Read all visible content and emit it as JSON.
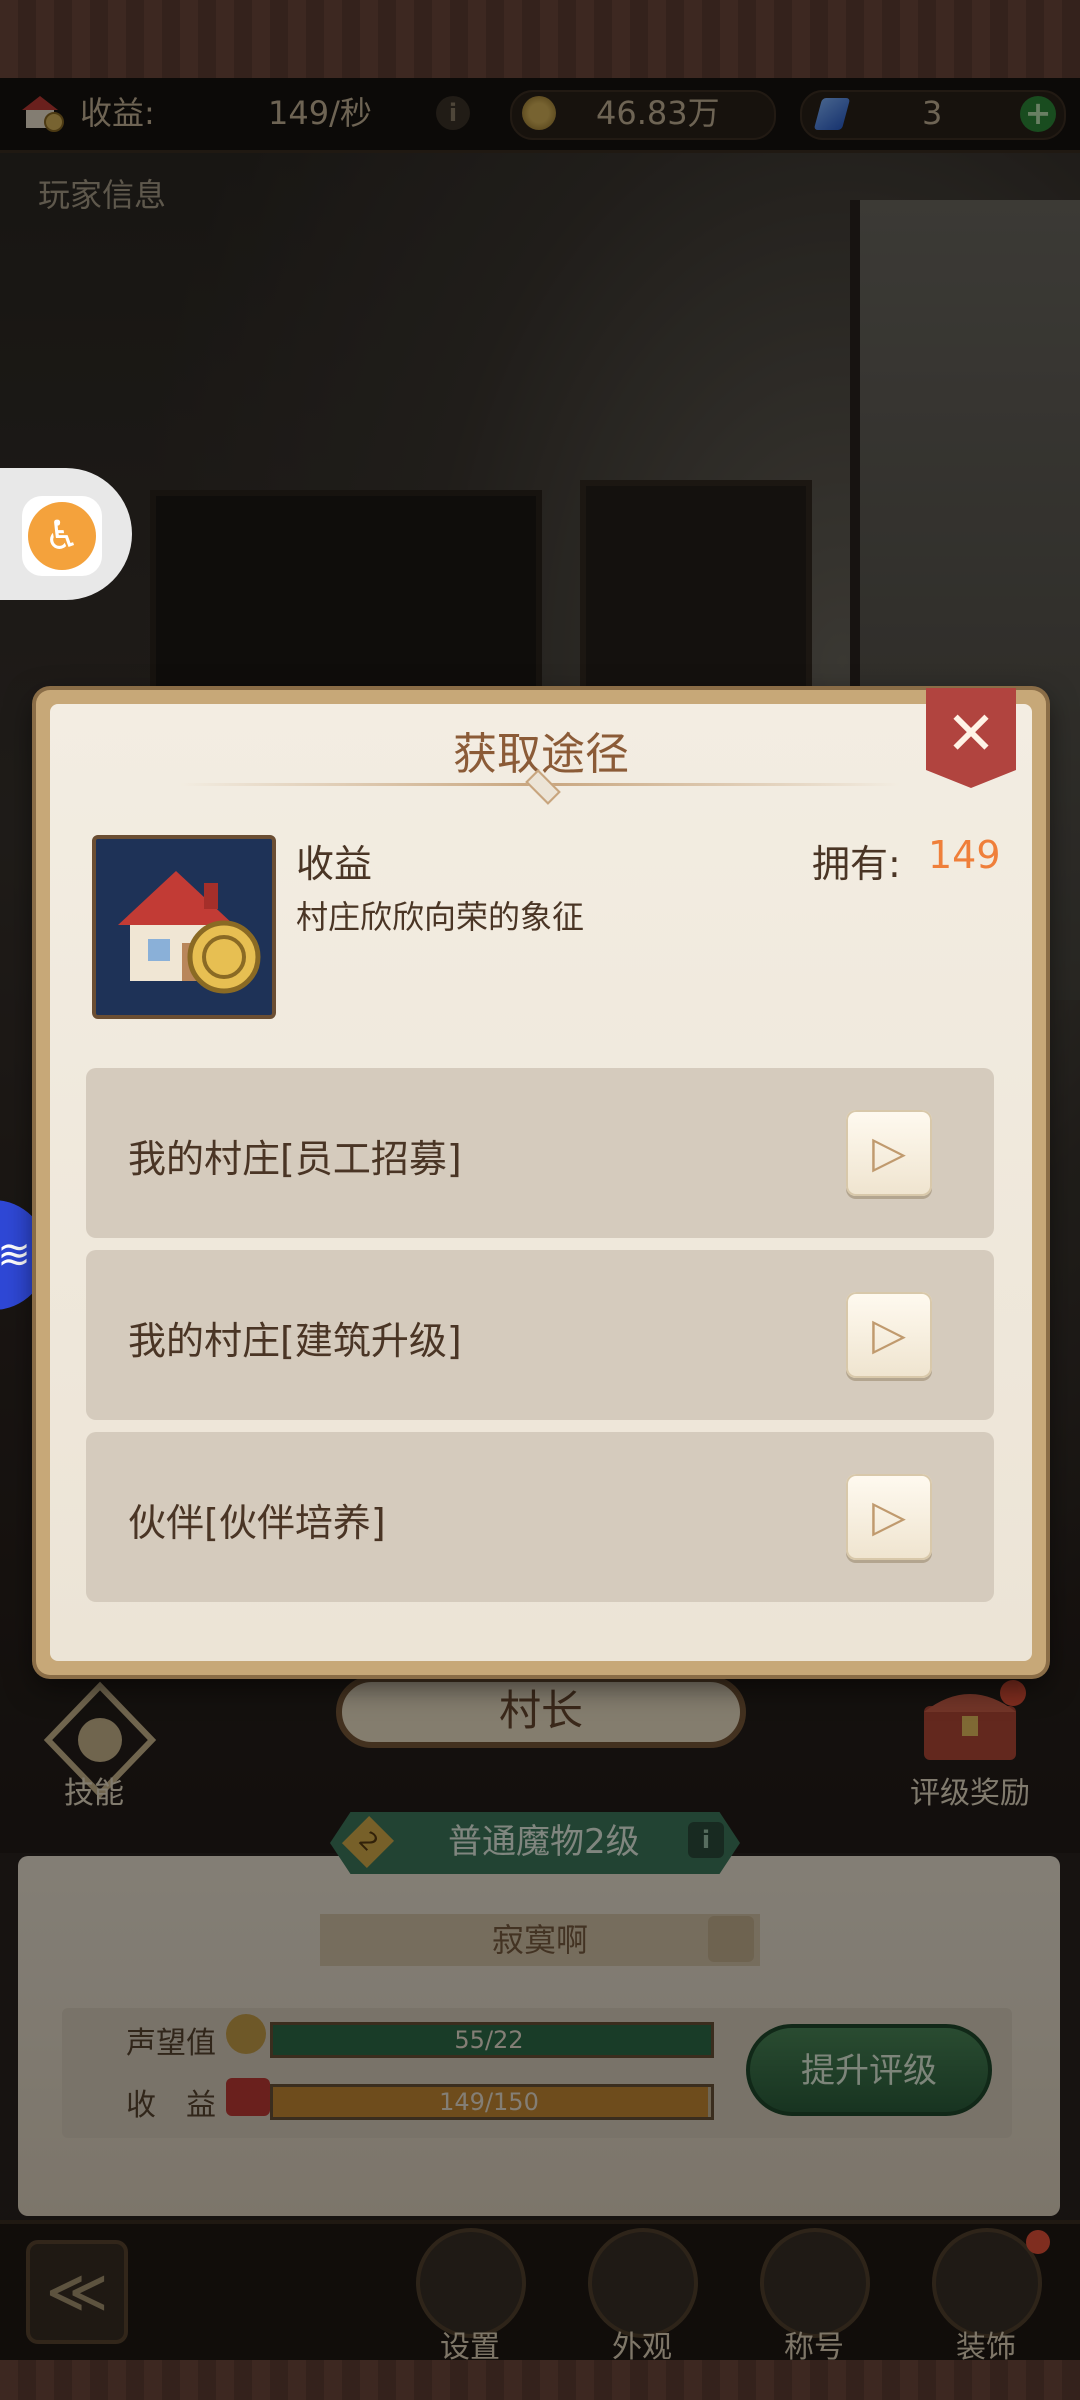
{
  "top_bar": {
    "income_label": "收益:",
    "income_value": "149/秒",
    "info_glyph": "i",
    "coins_value": "46.83万",
    "gems_value": "3",
    "plus_glyph": "+"
  },
  "page": {
    "player_info_label": "玩家信息"
  },
  "dialog": {
    "title": "获取途径",
    "close_glyph": "✕",
    "item": {
      "icon": "house-coin-icon",
      "name": "收益",
      "description": "村庄欣欣向荣的象征",
      "own_label": "拥有:",
      "own_value": "149"
    },
    "paths": [
      {
        "label": "我的村庄[员工招募]",
        "button_glyph": "▷"
      },
      {
        "label": "我的村庄[建筑升级]",
        "button_glyph": "▷"
      },
      {
        "label": "伙伴[伙伴培养]",
        "button_glyph": "▷"
      }
    ]
  },
  "character": {
    "name_plate": "村长",
    "skill_label": "技能",
    "rating_reward_label": "评级奖励",
    "rank_number": "2",
    "rank_title": "普通魔物2级",
    "rank_info_glyph": "i",
    "mood_text": "寂寞啊"
  },
  "stats": {
    "reputation_label": "声望值",
    "reputation_value": "55/22",
    "reputation_fill": 1.0,
    "income_label": "收　益",
    "income_value": "149/150",
    "income_fill": 0.993,
    "upgrade_button": "提升评级"
  },
  "bottom_nav": {
    "back_glyph": "≪",
    "items": [
      {
        "label": "设置",
        "icon": "gear-icon"
      },
      {
        "label": "外观",
        "icon": "outfit-icon"
      },
      {
        "label": "称号",
        "icon": "crown-icon"
      },
      {
        "label": "装饰",
        "icon": "mushroom-icon"
      }
    ]
  },
  "colors": {
    "accent_orange": "#ef7f3a",
    "dialog_brown_text": "#8b5b37",
    "close_red": "#b1443f"
  }
}
